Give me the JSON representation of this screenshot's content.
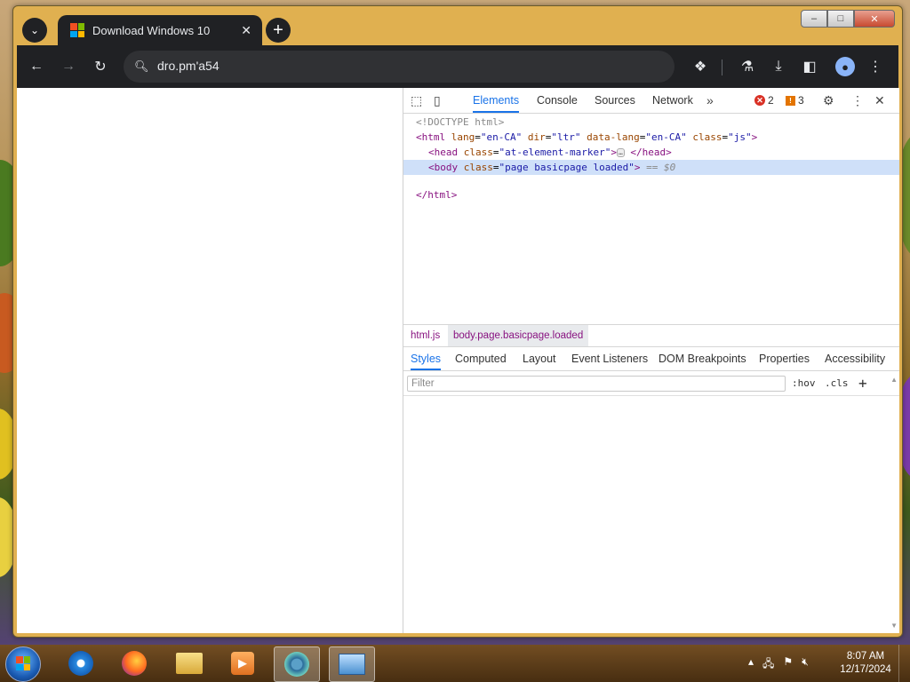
{
  "browser": {
    "tab_title": "Download Windows 10",
    "url": "dro.pm'a54"
  },
  "devtools": {
    "tabs": [
      "Elements",
      "Console",
      "Sources",
      "Network"
    ],
    "more_tabs_icon": "chevron-double-right-icon",
    "error_count": "2",
    "warning_count": "3",
    "dom_lines": {
      "doctype": "<!DOCTYPE html>",
      "html_tag": "html",
      "html_attrs": [
        {
          "name": "lang",
          "value": "\"en-CA\""
        },
        {
          "name": "dir",
          "value": "\"ltr\""
        },
        {
          "name": "data-lang",
          "value": "\"en-CA\""
        },
        {
          "name": "class",
          "value": "\"js\""
        }
      ],
      "head_tag": "head",
      "head_attr_name": "class",
      "head_attr_value": "\"at-element-marker\"",
      "head_close": "</head>",
      "ellipsis": "…",
      "body_tag": "body",
      "body_attr_name": "class",
      "body_attr_value": "\"page basicpage loaded\"",
      "body_marker": "== $0",
      "html_close": "</html>"
    },
    "breadcrumbs": [
      "html.js",
      "body.page.basicpage.loaded"
    ],
    "styles_tabs": [
      "Styles",
      "Computed",
      "Layout",
      "Event Listeners",
      "DOM Breakpoints",
      "Properties",
      "Accessibility"
    ],
    "filter_placeholder": "Filter",
    "hov_label": ":hov",
    "cls_label": ".cls",
    "add_rule": "+"
  },
  "taskbar": {
    "time": "8:07 AM",
    "date": "12/17/2024"
  },
  "colors": {
    "accent": "#1a73e8",
    "chrome_dark": "#202124",
    "selected_row": "#cfe0f9"
  }
}
